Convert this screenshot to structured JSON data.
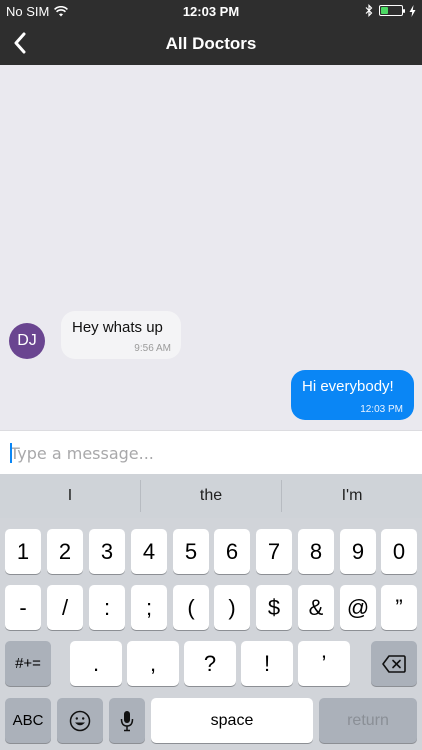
{
  "status_bar": {
    "carrier": "No SIM",
    "time": "12:03 PM",
    "battery_level": 0.35
  },
  "nav": {
    "title": "All Doctors"
  },
  "chat": {
    "incoming": {
      "avatar_initials": "DJ",
      "text": "Hey whats up",
      "time": "9:56 AM"
    },
    "outgoing": {
      "text": "Hi everybody!",
      "time": "12:03 PM"
    }
  },
  "composer": {
    "placeholder": "Type a message..."
  },
  "keyboard": {
    "suggestions": [
      "I",
      "the",
      "I'm"
    ],
    "row1": [
      "1",
      "2",
      "3",
      "4",
      "5",
      "6",
      "7",
      "8",
      "9",
      "0"
    ],
    "row2": [
      "-",
      "/",
      ":",
      ";",
      "(",
      ")",
      "$",
      "&",
      "@",
      "”"
    ],
    "row3": [
      ".",
      ",",
      "?",
      "!",
      "’"
    ],
    "symbols_label": "#+=",
    "abc_label": "ABC",
    "space_label": "space",
    "return_label": "return"
  }
}
